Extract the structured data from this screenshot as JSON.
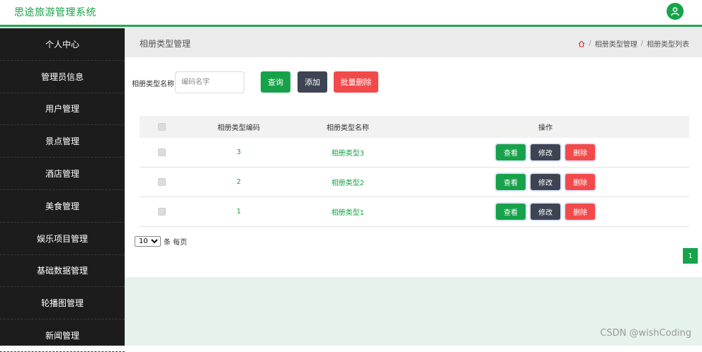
{
  "app": {
    "title": "思途旅游管理系统",
    "avatar_icon": "user-icon",
    "accent_color": "#16a34a"
  },
  "sidebar": {
    "items": [
      {
        "label": "个人中心"
      },
      {
        "label": "管理员信息"
      },
      {
        "label": "用户管理"
      },
      {
        "label": "景点管理"
      },
      {
        "label": "酒店管理"
      },
      {
        "label": "美食管理"
      },
      {
        "label": "娱乐项目管理"
      },
      {
        "label": "基础数据管理"
      },
      {
        "label": "轮播图管理"
      },
      {
        "label": "新闻管理"
      }
    ]
  },
  "header": {
    "page_title": "相册类型管理",
    "breadcrumb": [
      "相册类型管理",
      "相册类型列表"
    ],
    "breadcrumb_sep": "/"
  },
  "search": {
    "label": "相册类型名称",
    "placeholder": "编码名字",
    "value": "",
    "query_label": "查询",
    "add_label": "添加",
    "batch_delete_label": "批量删除"
  },
  "table": {
    "headers": [
      "相册类型编码",
      "相册类型名称",
      "操作"
    ],
    "rows": [
      {
        "code": "3",
        "name": "相册类型3"
      },
      {
        "code": "2",
        "name": "相册类型2"
      },
      {
        "code": "1",
        "name": "相册类型1"
      }
    ],
    "actions": {
      "view": "查看",
      "edit": "修改",
      "delete": "删除"
    }
  },
  "pagination": {
    "per_page": "10",
    "per_page_options": [
      "10"
    ],
    "per_page_text": "条 每页",
    "current_page": "1"
  },
  "watermark": "CSDN @wishCoding"
}
